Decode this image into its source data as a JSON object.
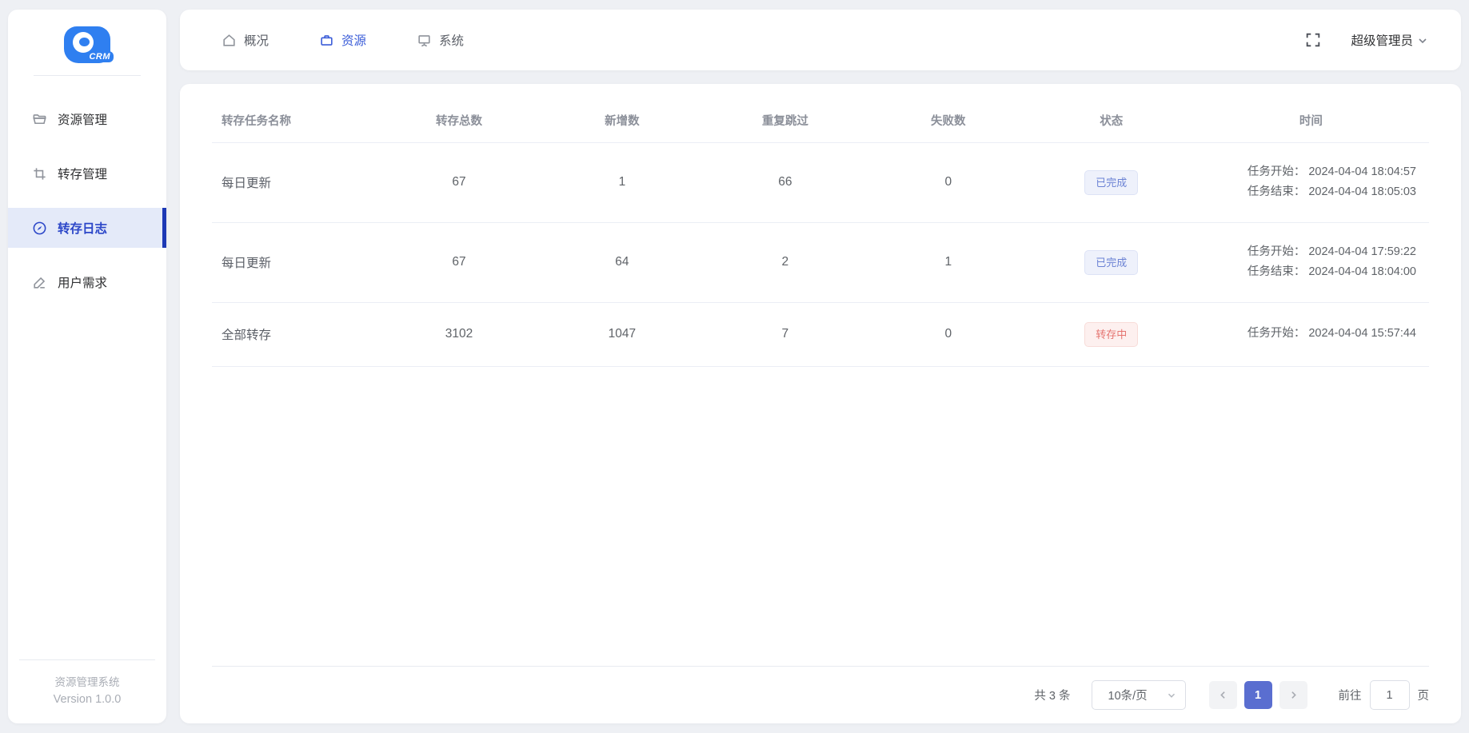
{
  "app": {
    "logo_text": "CRM",
    "footer_line1": "资源管理系统",
    "footer_line2": "Version 1.0.0"
  },
  "sidebar": {
    "items": [
      {
        "label": "资源管理",
        "icon": "folder-icon",
        "active": false
      },
      {
        "label": "转存管理",
        "icon": "crop-icon",
        "active": false
      },
      {
        "label": "转存日志",
        "icon": "log-circle-icon",
        "active": true
      },
      {
        "label": "用户需求",
        "icon": "pen-icon",
        "active": false
      }
    ]
  },
  "topnav": {
    "items": [
      {
        "label": "概况",
        "icon": "home-icon",
        "active": false
      },
      {
        "label": "资源",
        "icon": "briefcase-icon",
        "active": true
      },
      {
        "label": "系统",
        "icon": "monitor-icon",
        "active": false
      }
    ],
    "fullscreen_icon": "fullscreen-icon",
    "user_name": "超级管理员"
  },
  "table": {
    "headers": {
      "name": "转存任务名称",
      "total": "转存总数",
      "added": "新增数",
      "skipped": "重复跳过",
      "failed": "失败数",
      "status": "状态",
      "time": "时间"
    },
    "rows": [
      {
        "name": "每日更新",
        "total": "67",
        "added": "1",
        "skipped": "66",
        "failed": "0",
        "status": "已完成",
        "status_type": "success",
        "time_line1": "任务开始： 2024-04-04 18:04:57",
        "time_line2": "任务结束： 2024-04-04 18:05:03"
      },
      {
        "name": "每日更新",
        "total": "67",
        "added": "64",
        "skipped": "2",
        "failed": "1",
        "status": "已完成",
        "status_type": "success",
        "time_line1": "任务开始： 2024-04-04 17:59:22",
        "time_line2": "任务结束： 2024-04-04 18:04:00"
      },
      {
        "name": "全部转存",
        "total": "3102",
        "added": "1047",
        "skipped": "7",
        "failed": "0",
        "status": "转存中",
        "status_type": "danger",
        "time_line1": "任务开始： 2024-04-04 15:57:44",
        "time_line2": ""
      }
    ]
  },
  "pagination": {
    "total_text": "共 3 条",
    "page_size": "10条/页",
    "current_page": "1",
    "goto_label": "前往",
    "goto_value": "1",
    "goto_suffix": "页"
  },
  "colors": {
    "primary_blue": "#3a5cd8",
    "sidebar_active_bg": "#e4eaf9",
    "sidebar_indicator": "#1d39b5",
    "page_active_bg": "#5a6ed0",
    "badge_success_text": "#6b82d4",
    "badge_success_bg": "#eef1fb",
    "badge_danger_text": "#e57470",
    "badge_danger_bg": "#fdf0ef",
    "logo_blue": "#2f7ff0"
  }
}
